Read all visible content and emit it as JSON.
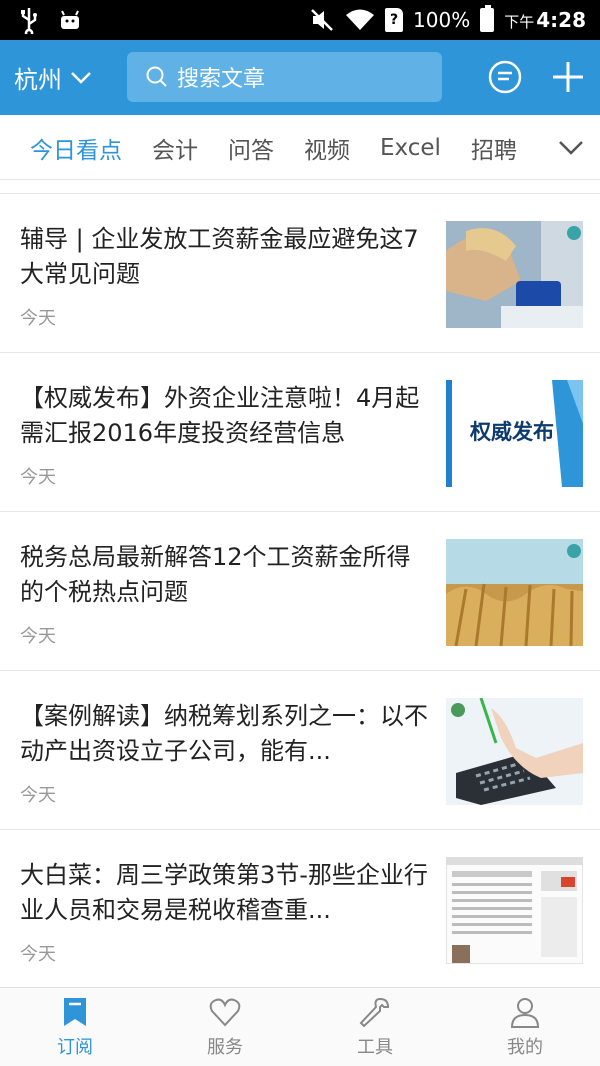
{
  "status_bar": {
    "battery": "100%",
    "clock_prefix": "下午",
    "clock": "4:28",
    "sim_label": "?"
  },
  "header": {
    "city": "杭州",
    "search_placeholder": "搜索文章",
    "accent_color": "#2e95d8"
  },
  "categories": [
    {
      "label": "今日看点",
      "active": true
    },
    {
      "label": "会计"
    },
    {
      "label": "问答"
    },
    {
      "label": "视频"
    },
    {
      "label": "Excel"
    },
    {
      "label": "招聘"
    }
  ],
  "articles": [
    {
      "title": "辅导 | 企业发放工资薪金最应避免这7大常见问题",
      "date": "今天",
      "thumb": "office-worker-photo"
    },
    {
      "title": "【权威发布】外资企业注意啦！4月起需汇报2016年度投资经营信息",
      "date": "今天",
      "thumb": "authority-release-banner",
      "thumb_text": "权威发布"
    },
    {
      "title": "税务总局最新解答12个工资薪金所得的个税热点问题",
      "date": "今天",
      "thumb": "wheat-field-photo"
    },
    {
      "title": "【案例解读】纳税筹划系列之一：以不动产出资设立子公司，能有...",
      "date": "今天",
      "thumb": "calculator-photo"
    },
    {
      "title": "大白菜：周三学政策第3节-那些企业行业人员和交易是税收稽查重...",
      "date": "今天",
      "thumb": "webpage-screenshot"
    }
  ],
  "bottom_nav": [
    {
      "label": "订阅",
      "icon": "bookmark-icon",
      "active": true
    },
    {
      "label": "服务",
      "icon": "heart-icon"
    },
    {
      "label": "工具",
      "icon": "wrench-icon"
    },
    {
      "label": "我的",
      "icon": "person-icon"
    }
  ]
}
